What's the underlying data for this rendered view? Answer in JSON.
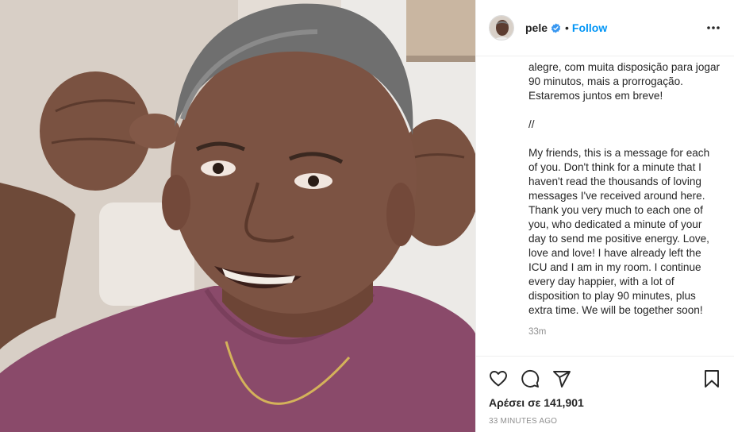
{
  "header": {
    "username": "pele",
    "separator": "•",
    "follow_label": "Follow",
    "more_icon": "more-horizontal-icon",
    "verified_icon": "verified-badge-icon",
    "verified_color": "#3897f0"
  },
  "caption": {
    "text": "feliz\nalegre, com muita disposição para jogar 90 minutos, mais a prorrogação. Estaremos juntos em breve!\n\n//\n\nMy friends, this is a message for each of you. Don't think for a minute that I haven't read the thousands of loving messages I've received around here. Thank you very much to each one of you, who dedicated a minute of your day to send me positive energy. Love, love and love! I have already left the ICU and I am in my room. I continue every day happier, with a lot of disposition to play 90 minutes, plus extra time. We will be together soon!",
    "time": "33m"
  },
  "actions": {
    "like_icon": "heart-icon",
    "comment_icon": "comment-bubble-icon",
    "share_icon": "paper-plane-icon",
    "save_icon": "bookmark-icon"
  },
  "likes_text": "Αρέσει σε 141,901",
  "posted_time": "33 MINUTES AGO",
  "colors": {
    "accent": "#0095f6",
    "text": "#262626",
    "muted": "#8e8e8e",
    "border": "#efefef",
    "shirt": "#8a4a6a"
  }
}
